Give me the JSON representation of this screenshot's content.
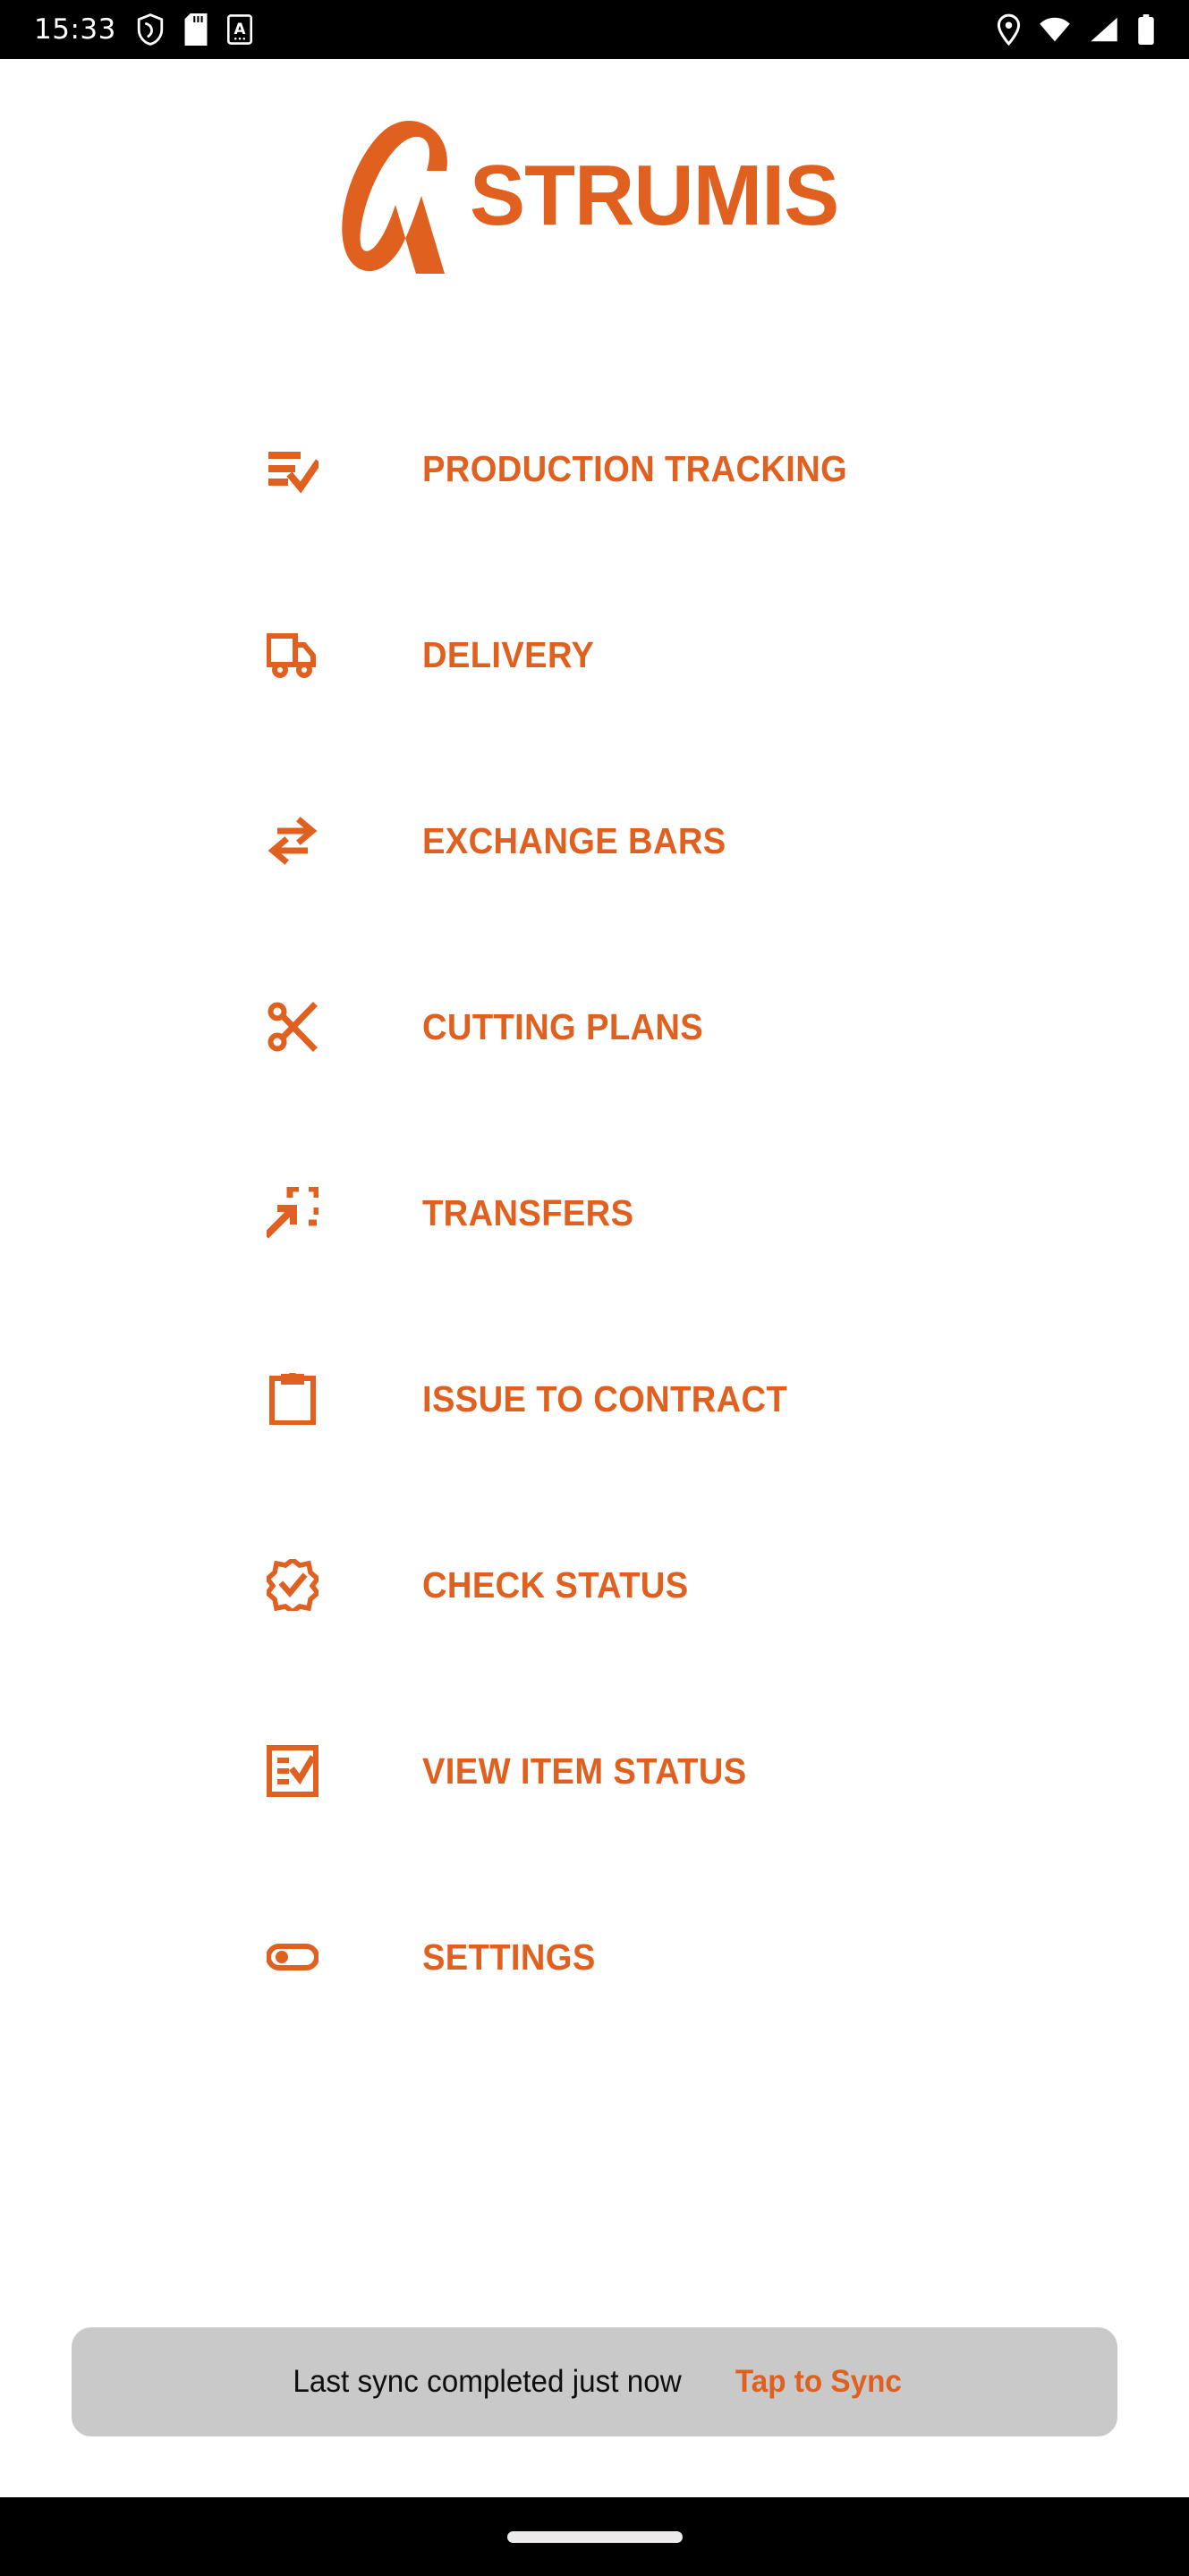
{
  "status_bar": {
    "time": "15:33",
    "left_icons": [
      "shield-icon",
      "sd-card-icon",
      "alphabet-a-icon"
    ],
    "right_icons": [
      "location-pin-icon",
      "wifi-icon",
      "cellular-signal-icon",
      "battery-icon"
    ]
  },
  "brand": {
    "logo_mark": "strumis-a-logo-icon",
    "name": "STRUMIS",
    "color": "#E0601F"
  },
  "menu": {
    "items": [
      {
        "label": "PRODUCTION TRACKING",
        "icon": "list-check-icon"
      },
      {
        "label": "DELIVERY",
        "icon": "truck-icon"
      },
      {
        "label": "EXCHANGE BARS",
        "icon": "swap-arrows-icon"
      },
      {
        "label": "CUTTING PLANS",
        "icon": "scissors-icon"
      },
      {
        "label": "TRANSFERS",
        "icon": "move-into-frame-icon"
      },
      {
        "label": "ISSUE TO CONTRACT",
        "icon": "clipboard-icon"
      },
      {
        "label": "CHECK STATUS",
        "icon": "verified-badge-icon"
      },
      {
        "label": "VIEW ITEM STATUS",
        "icon": "checklist-box-icon"
      },
      {
        "label": "SETTINGS",
        "icon": "toggle-switch-icon"
      }
    ]
  },
  "sync": {
    "status_text": "Last sync completed just now",
    "action_label": "Tap to Sync",
    "background": "#C9C9C9"
  },
  "nav_bar": {
    "gesture_pill": "home-gesture-pill"
  }
}
